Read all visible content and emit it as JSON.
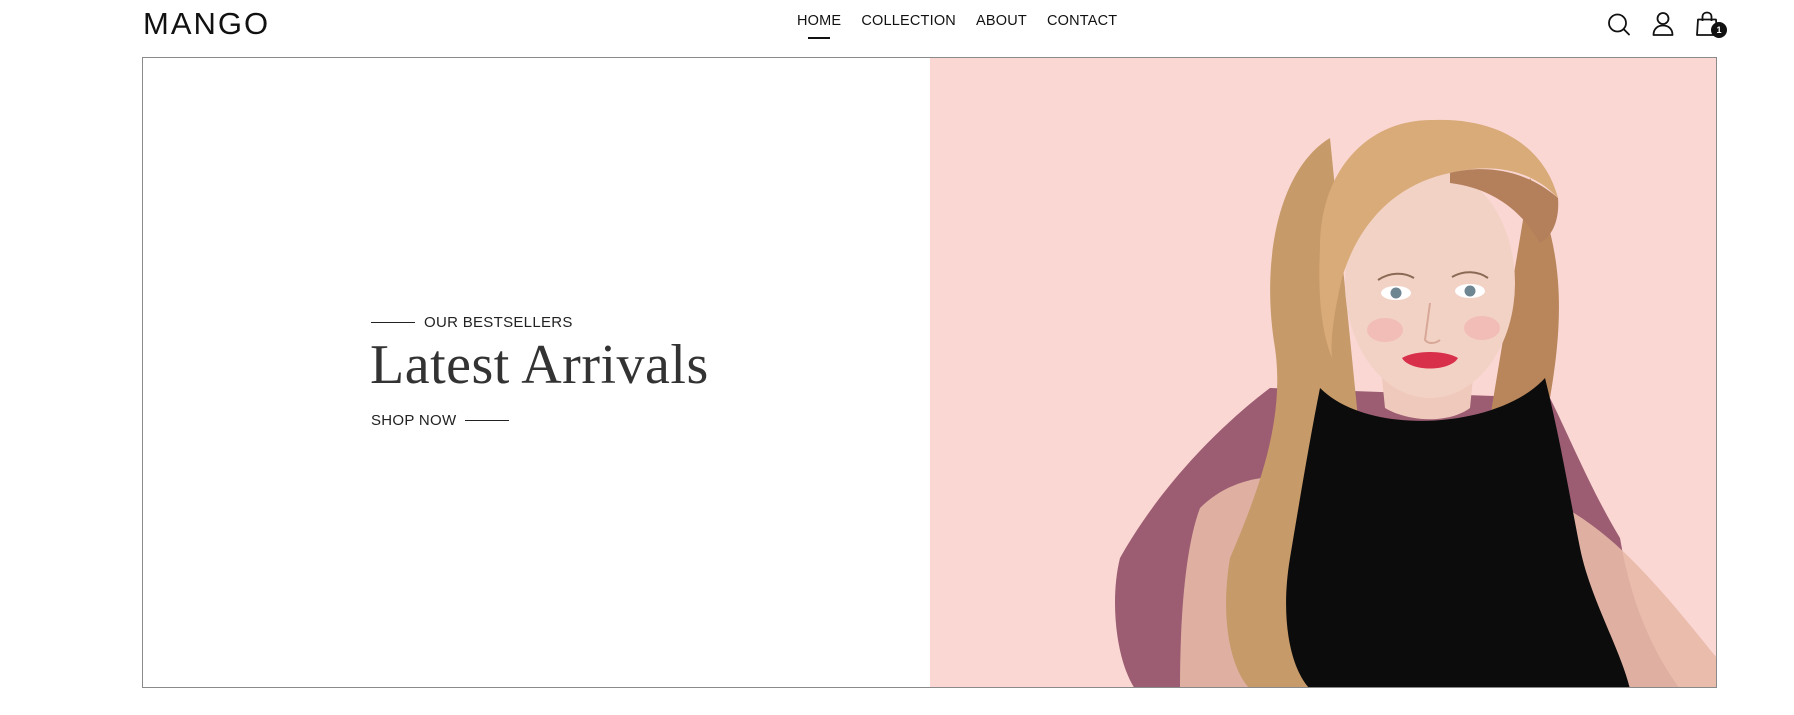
{
  "brand": {
    "logo_text": "MANGO"
  },
  "nav": {
    "items": [
      {
        "label": "HOME",
        "active": true
      },
      {
        "label": "COLLECTION",
        "active": false
      },
      {
        "label": "ABOUT",
        "active": false
      },
      {
        "label": "CONTACT",
        "active": false
      }
    ]
  },
  "header_icons": {
    "search": "search-icon",
    "account": "user-icon",
    "cart": "shopping-bag-icon",
    "cart_count": "1"
  },
  "hero": {
    "eyebrow": "OUR BESTSELLERS",
    "headline": "Latest Arrivals",
    "cta_label": "SHOP NOW",
    "image_background": "#fbd7d4"
  },
  "colors": {
    "text": "#222222",
    "border": "#8a8a8a",
    "accent_pink": "#fbd7d4"
  }
}
